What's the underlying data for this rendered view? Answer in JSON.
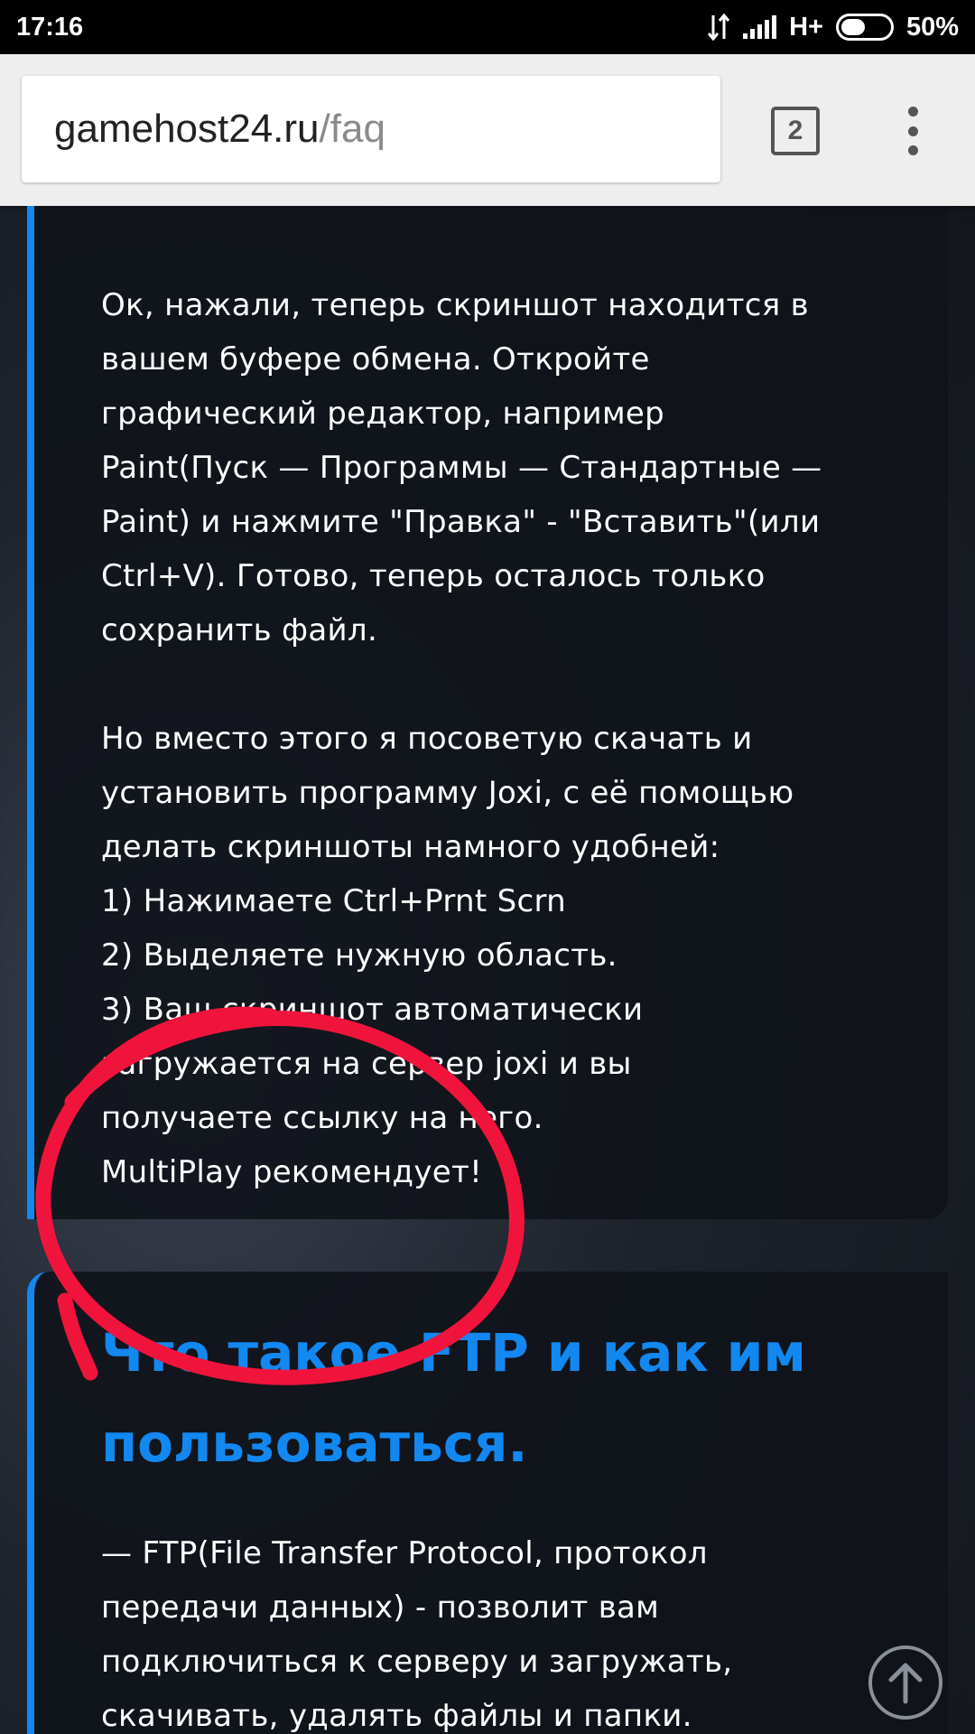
{
  "status_bar": {
    "time": "17:16",
    "network": "H+",
    "battery": "50%"
  },
  "browser": {
    "url_domain": "gamehost24.ru",
    "url_path": "/faq",
    "tab_count": "2"
  },
  "card1": {
    "paragraph1": [
      "Ок, нажали, теперь скриншот находится в",
      "вашем буфере обмена. Откройте",
      "графический редактор, например",
      "Paint(Пуск — Программы — Стандартные —",
      "Paint) и нажмите \"Правка\" - \"Вставить\"(или",
      "Ctrl+V). Готово, теперь осталось только",
      "сохранить файл."
    ],
    "paragraph2": [
      "Но вместо этого я посоветую скачать и",
      "установить программу Joxi, с её помощью",
      "делать скриншоты намного удобней:",
      "1) Нажимаете Ctrl+Prnt Scrn",
      "2) Выделяете нужную область.",
      "3) Ваш скриншот автоматически",
      "загружается на сервер joxi и вы",
      "получаете ссылку на него.",
      "MultiPlay рекомендует!"
    ]
  },
  "card2": {
    "title_lines": [
      "Что такое FTP и как им",
      "пользоваться."
    ],
    "body": [
      "— FTP(File Transfer Protocol, протокол",
      "передачи данных) - позволит вам",
      "подключиться к серверу и загружать,",
      "скачивать, удалять файлы и папки."
    ]
  },
  "colors": {
    "accent": "#1288f0",
    "annotation": "#f0143c"
  },
  "icons": {
    "tabs": "tabs-count-icon",
    "menu": "overflow-menu-icon",
    "scroll_top": "arrow-up-icon"
  }
}
